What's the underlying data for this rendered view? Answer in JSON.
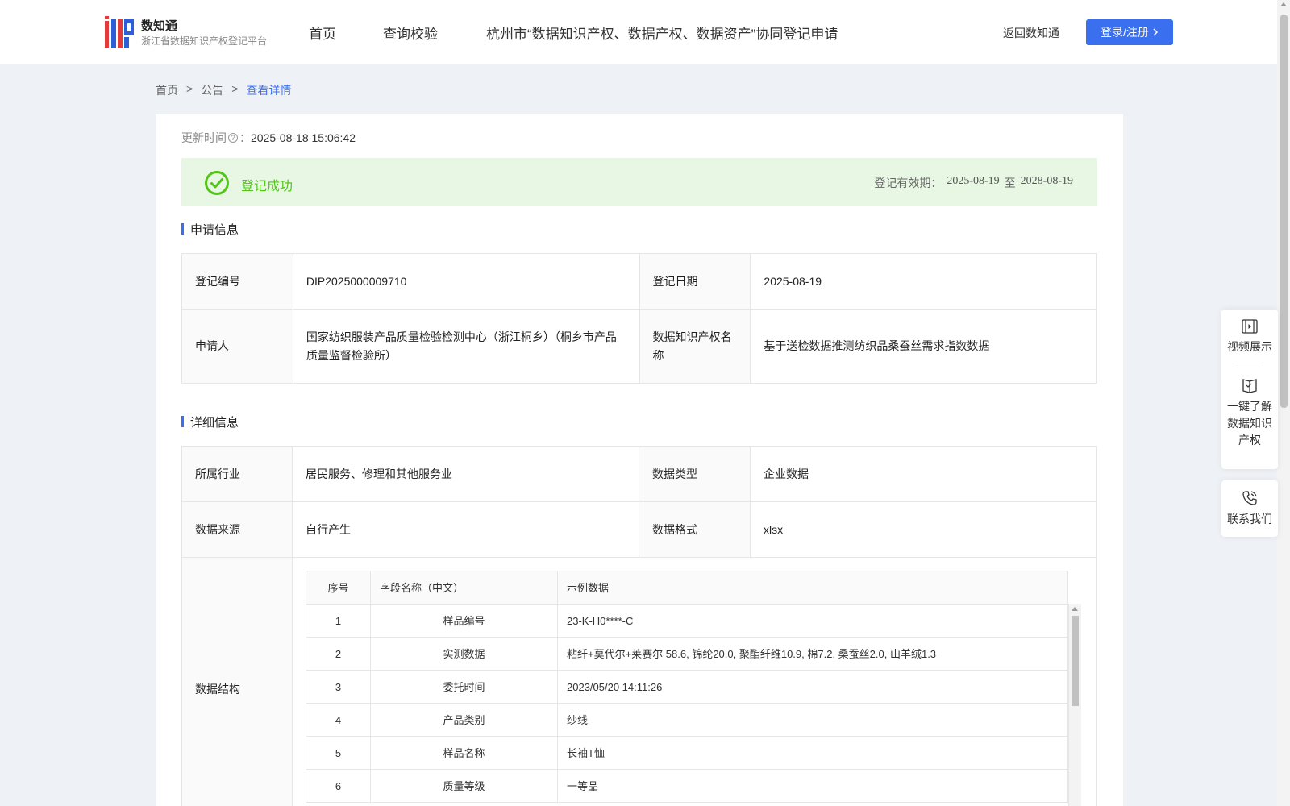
{
  "header": {
    "logo_title": "数知通",
    "logo_subtitle": "浙江省数据知识产权登记平台",
    "nav": [
      "首页",
      "查询校验",
      "杭州市“数据知识产权、数据产权、数据资产”协同登记申请"
    ],
    "back_link": "返回数知通",
    "login_button": "登录/注册"
  },
  "breadcrumb": [
    "首页",
    ">",
    "公告",
    ">",
    "查看详情"
  ],
  "update": {
    "label": "更新时间",
    "separator": "：",
    "value": "2025-08-18 15:06:42"
  },
  "status": {
    "text": "登记成功",
    "validity_label": "登记有效期：",
    "validity_start": "2025-08-19",
    "validity_to": "至",
    "validity_end": "2028-08-19"
  },
  "application_section": {
    "title": "申请信息",
    "reg_no_label": "登记编号",
    "reg_no": "DIP2025000009710",
    "reg_date_label": "登记日期",
    "reg_date": "2025-08-19",
    "applicant_label": "申请人",
    "applicant": "国家纺织服装产品质量检验检测中心（浙江桐乡）（桐乡市产品质量监督检验所）",
    "ip_name_label": "数据知识产权名称",
    "ip_name": "基于送检数据推测纺织品桑蚕丝需求指数数据"
  },
  "detail_section": {
    "title": "详细信息",
    "industry_label": "所属行业",
    "industry": "居民服务、修理和其他服务业",
    "data_type_label": "数据类型",
    "data_type": "企业数据",
    "source_label": "数据来源",
    "source": "自行产生",
    "format_label": "数据格式",
    "format": "xlsx",
    "structure_label": "数据结构",
    "structure_headers": [
      "序号",
      "字段名称（中文）",
      "示例数据"
    ],
    "structure_rows": [
      {
        "no": "1",
        "field": "样品编号",
        "example": "23-K-H0****-C"
      },
      {
        "no": "2",
        "field": "实测数据",
        "example": "粘纤+莫代尔+莱赛尔 58.6, 锦纶20.0, 聚酯纤维10.9, 棉7.2, 桑蚕丝2.0, 山羊绒1.3"
      },
      {
        "no": "3",
        "field": "委托时间",
        "example": "2023/05/20 14:11:26"
      },
      {
        "no": "4",
        "field": "产品类别",
        "example": "纱线"
      },
      {
        "no": "5",
        "field": "样品名称",
        "example": "长袖T恤"
      },
      {
        "no": "6",
        "field": "质量等级",
        "example": "一等品"
      }
    ]
  },
  "side_panel": {
    "video": "视频展示",
    "learn": [
      "一键了解",
      "数据知识",
      "产权"
    ],
    "contact": "联系我们"
  },
  "colors": {
    "accent": "#3a6ff0",
    "success": "#52c41a",
    "success_bg": "#e8f7e3"
  }
}
